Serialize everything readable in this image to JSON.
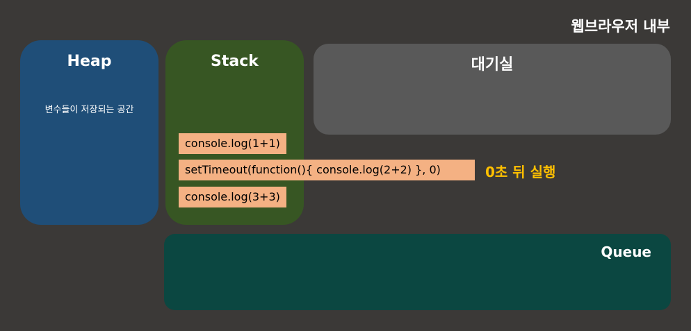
{
  "header": {
    "title": "웹브라우저 내부"
  },
  "heap": {
    "title": "Heap",
    "description": "변수들이 저장되는 공간"
  },
  "stack": {
    "title": "Stack",
    "calls": [
      "console.log(1+1)",
      "setTimeout(function(){ console.log(2+2) }, 0)",
      "console.log(3+3)"
    ]
  },
  "waiting_room": {
    "title": "대기실"
  },
  "queue": {
    "title": "Queue"
  },
  "annotation": {
    "text": "0초 뒤 실행"
  },
  "colors": {
    "background": "#3b3937",
    "heap": "#1f4e78",
    "stack": "#375623",
    "waiting_room": "#595959",
    "queue": "#0b4741",
    "call_box": "#f4b183",
    "annotation": "#ffc000"
  }
}
